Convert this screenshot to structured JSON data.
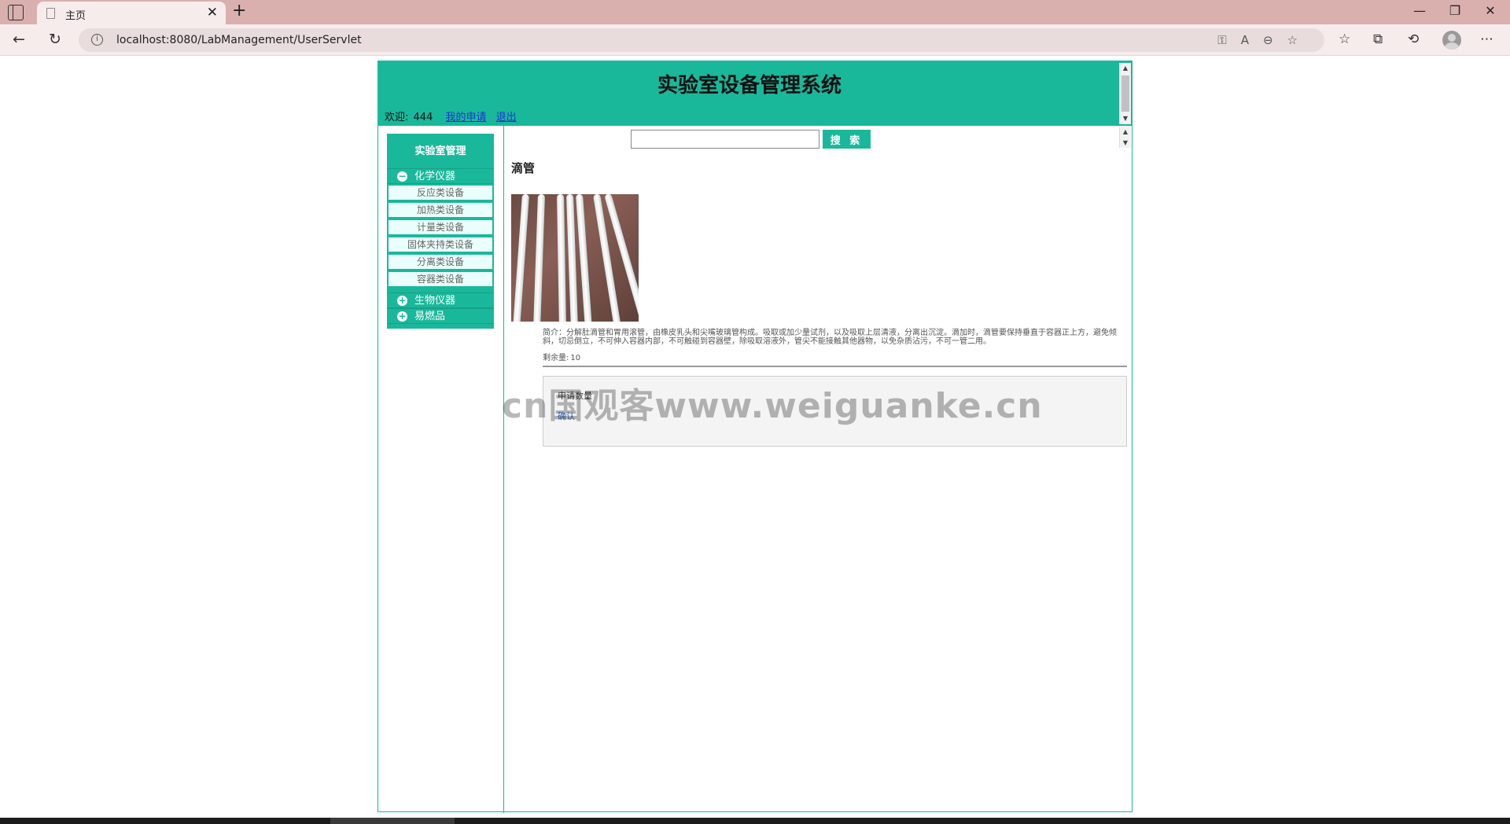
{
  "browser": {
    "tab_title": "主页",
    "url": "localhost:8080/LabManagement/UserServlet"
  },
  "header": {
    "title": "实验室设备管理系统",
    "welcome_label": "欢迎:",
    "username": "444",
    "my_requests": "我的申请",
    "logout": "退出"
  },
  "sidebar": {
    "title": "实验室管理",
    "categories": [
      {
        "label": "化学仪器",
        "expanded": true,
        "items": [
          "反应类设备",
          "加热类设备",
          "计量类设备",
          "固体夹持类设备",
          "分离类设备",
          "容器类设备"
        ]
      },
      {
        "label": "生物仪器",
        "expanded": false
      },
      {
        "label": "易燃品",
        "expanded": false
      }
    ]
  },
  "search": {
    "value": "",
    "button": "搜 索"
  },
  "item": {
    "name": "滴管",
    "description": "简介：分解肚滴管和胃用滚管，由橡皮乳头和尖嘴玻璃管构成。吸取或加少量试剂，以及吸取上层清液，分离出沉淀。滴加时，滴管要保持垂直于容器正上方，避免倾斜，切忌倒立，不可伸入容器内部，不可触碰到容器壁，除吸取溶液外，管尖不能接触其他器物，以免杂质沾污，不可一管二用。",
    "remaining_label": "剩余量:",
    "remaining": "10"
  },
  "apply": {
    "label": "申请数量",
    "confirm": "确认"
  },
  "watermark": "cn国观客www.weiguanke.cn",
  "colors": {
    "accent": "#1ab89b",
    "tabbar": "#d9b0ae",
    "link": "#1f33d2"
  }
}
